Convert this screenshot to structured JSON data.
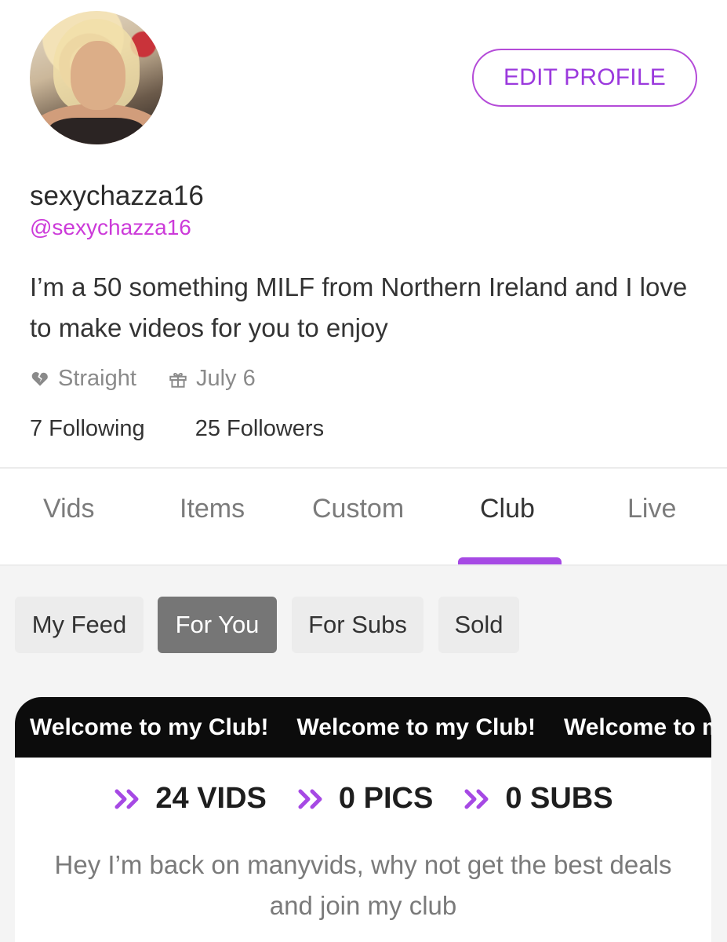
{
  "profile": {
    "display_name": "sexychazza16",
    "handle": "@sexychazza16",
    "bio": "I’m a 50 something MILF from Northern Ireland and I love to make videos for you to enjoy",
    "orientation": "Straight",
    "birthday": "July 6",
    "following": "7 Following",
    "followers": "25 Followers",
    "edit_label": "EDIT PROFILE"
  },
  "tabs": [
    {
      "label": "Vids"
    },
    {
      "label": "Items"
    },
    {
      "label": "Custom"
    },
    {
      "label": "Club",
      "active": true
    },
    {
      "label": "Live"
    }
  ],
  "filters": [
    {
      "label": "My Feed"
    },
    {
      "label": "For You",
      "active": true
    },
    {
      "label": "For Subs"
    },
    {
      "label": "Sold"
    }
  ],
  "club": {
    "banner_items": [
      "Welcome to my Club!",
      "Welcome to my Club!",
      "Welcome to my Club!"
    ],
    "vids": "24 VIDS",
    "pics": "0 PICS",
    "subs": "0 SUBS",
    "description": "Hey I’m back on manyvids, why not get the best deals and join my club"
  },
  "colors": {
    "accent": "#9b39dd",
    "handle": "#cc3ad9",
    "active_filter": "#767676",
    "banner": "#0c0c0c"
  },
  "icons": {
    "orientation": "heart-broken-icon",
    "birthday": "gift-icon",
    "stat_marker": "double-chevron-right-icon"
  }
}
